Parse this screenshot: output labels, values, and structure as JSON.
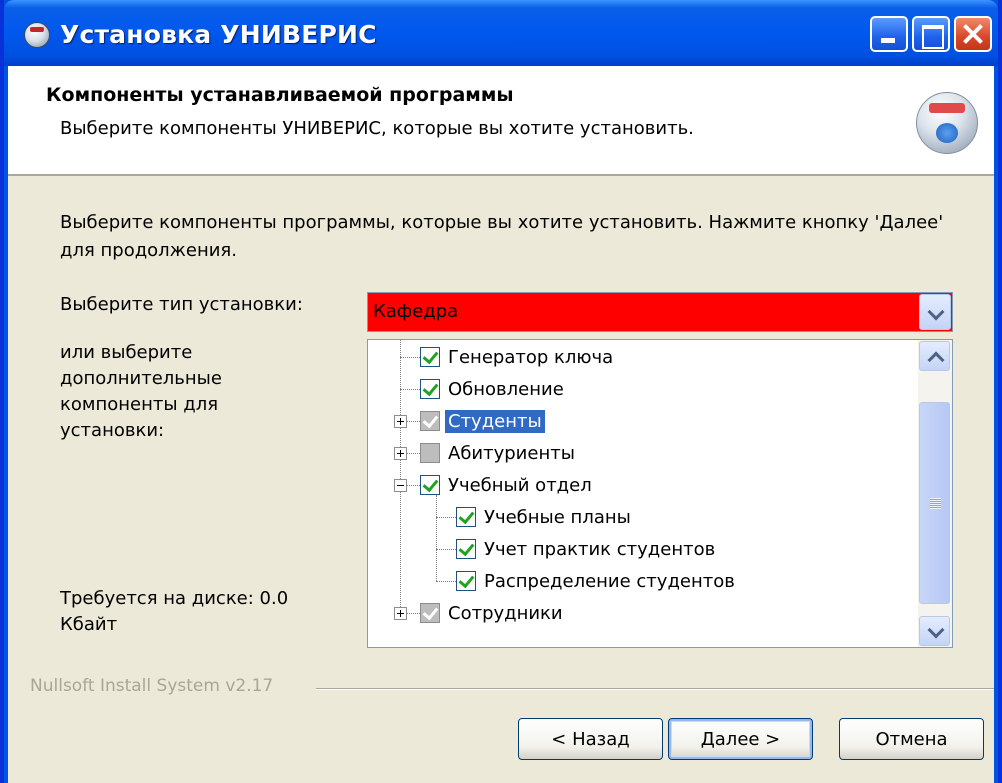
{
  "window": {
    "title": "Установка УНИВЕРИС",
    "icon": "installer-icon"
  },
  "header": {
    "title": "Компоненты устанавливаемой программы",
    "subtitle": "Выберите компоненты УНИВЕРИС, которые вы хотите установить.",
    "icon": "installer-disc-icon"
  },
  "body": {
    "description": "Выберите компоненты программы, которые вы хотите установить. Нажмите кнопку 'Далее' для продолжения.",
    "install_type_label": "Выберите тип установки:",
    "install_type_value": "Кафедра",
    "components_label": "или выберите дополнительные компоненты для установки:",
    "disk_required": "Требуется на диске: 0.0 Кбайт"
  },
  "tree": {
    "items": [
      {
        "label": "Генератор ключа",
        "checked": true,
        "grey": false,
        "level": 1,
        "expander": null,
        "selected": false
      },
      {
        "label": "Обновление",
        "checked": true,
        "grey": false,
        "level": 1,
        "expander": null,
        "selected": false
      },
      {
        "label": "Студенты",
        "checked": true,
        "grey": true,
        "level": 1,
        "expander": "plus",
        "selected": true
      },
      {
        "label": "Абитуриенты",
        "checked": false,
        "grey": true,
        "level": 1,
        "expander": "plus",
        "selected": false
      },
      {
        "label": "Учебный отдел",
        "checked": true,
        "grey": false,
        "level": 1,
        "expander": "minus",
        "selected": false
      },
      {
        "label": "Учебные планы",
        "checked": true,
        "grey": false,
        "level": 2,
        "expander": null,
        "selected": false
      },
      {
        "label": "Учет практик студентов",
        "checked": true,
        "grey": false,
        "level": 2,
        "expander": null,
        "selected": false
      },
      {
        "label": "Распределение студентов",
        "checked": true,
        "grey": false,
        "level": 2,
        "expander": null,
        "selected": false
      },
      {
        "label": "Сотрудники",
        "checked": true,
        "grey": true,
        "level": 1,
        "expander": "plus",
        "selected": false
      }
    ]
  },
  "footer": {
    "branding": "Nullsoft Install System v2.17",
    "back_label": "< Назад",
    "next_label": "Далее >",
    "cancel_label": "Отмена"
  },
  "colors": {
    "titlebar": "#0058ee",
    "combo_background": "#ff0000",
    "selection": "#316ac5",
    "dialog_face": "#ece9d8"
  }
}
